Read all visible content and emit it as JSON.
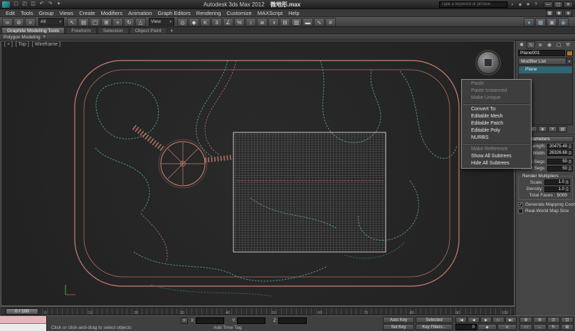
{
  "colors": {
    "road_accent": "#c97f70",
    "path_accent": "#57a093",
    "dark_path_accent": "#35704f",
    "selection_highlight": "#2e6672",
    "object_swatch": "#b4722c",
    "grid_line": "#c8c8c8",
    "red_dash": "#b34a42",
    "viewport_background": "#262626"
  },
  "title_bar": {
    "app_title": "Autodesk 3ds Max 2012",
    "document_name": "微地形.max",
    "search_placeholder": "Type a keyword or phrase",
    "quick_access": [
      {
        "name": "new-scene-icon",
        "glyph": "▢"
      },
      {
        "name": "open-file-icon",
        "glyph": "◰"
      },
      {
        "name": "save-file-icon",
        "glyph": "◫"
      },
      {
        "name": "undo-icon",
        "glyph": "↶"
      },
      {
        "name": "redo-icon",
        "glyph": "↷"
      },
      {
        "name": "project-folder-icon",
        "glyph": "▾"
      }
    ],
    "infocenter_icons": [
      {
        "name": "search-icon",
        "glyph": "⌕"
      },
      {
        "name": "communication-center-icon",
        "glyph": "◈"
      },
      {
        "name": "favorites-icon",
        "glyph": "★"
      },
      {
        "name": "help-icon",
        "glyph": "?"
      }
    ],
    "window_buttons": [
      {
        "name": "minimize-button",
        "glyph": "—"
      },
      {
        "name": "maximize-button",
        "glyph": "▢"
      },
      {
        "name": "close-button",
        "glyph": "✕"
      }
    ]
  },
  "menu_bar": {
    "items": [
      "Edit",
      "Tools",
      "Group",
      "Views",
      "Create",
      "Modifiers",
      "Animation",
      "Graph Editors",
      "Rendering",
      "Customize",
      "MAXScript",
      "Help"
    ],
    "right_icons": [
      {
        "name": "workspace-icon",
        "glyph": "▦"
      },
      {
        "name": "scene-explorer-icon",
        "glyph": "◉"
      },
      {
        "name": "info-icon",
        "glyph": "◈"
      }
    ]
  },
  "main_toolbar": {
    "group1": [
      {
        "name": "select-and-link-icon",
        "glyph": "∞"
      },
      {
        "name": "unlink-selection-icon",
        "glyph": "⊘"
      },
      {
        "name": "bind-to-space-warp-icon",
        "glyph": "≈"
      }
    ],
    "selection_filter_value": "All",
    "group2": [
      {
        "name": "select-object-icon",
        "glyph": "↖"
      },
      {
        "name": "select-by-name-icon",
        "glyph": "▤"
      },
      {
        "name": "selection-region-icon",
        "glyph": "▢"
      },
      {
        "name": "window-crossing-icon",
        "glyph": "⊞"
      },
      {
        "name": "select-and-move-icon",
        "glyph": "+"
      },
      {
        "name": "select-and-rotate-icon",
        "glyph": "↻"
      },
      {
        "name": "select-and-scale-icon",
        "glyph": "△"
      }
    ],
    "coord_system_value": "View",
    "group3": [
      {
        "name": "use-pivot-point-icon",
        "glyph": "◎"
      },
      {
        "name": "select-and-manipulate-icon",
        "glyph": "◆"
      },
      {
        "name": "keyboard-override-icon",
        "glyph": "K"
      },
      {
        "name": "snaps-toggle-icon",
        "glyph": "3"
      },
      {
        "name": "angle-snap-icon",
        "glyph": "∠"
      },
      {
        "name": "percent-snap-icon",
        "glyph": "%"
      },
      {
        "name": "spinner-snap-icon",
        "glyph": "↕"
      },
      {
        "name": "named-selection-sets-icon",
        "glyph": "≣"
      },
      {
        "name": "mirror-icon",
        "glyph": "◑"
      },
      {
        "name": "align-icon",
        "glyph": "⊟"
      },
      {
        "name": "layer-manager-icon",
        "glyph": "▥"
      },
      {
        "name": "graphite-ribbon-icon",
        "glyph": "▬"
      },
      {
        "name": "curve-editor-icon",
        "glyph": "∿"
      },
      {
        "name": "schematic-view-icon",
        "glyph": "#"
      }
    ],
    "group4": [
      {
        "name": "material-editor-icon",
        "glyph": "●",
        "color": "#49b8a8"
      },
      {
        "name": "render-setup-icon",
        "glyph": "▦",
        "color": "#9fb8d8"
      },
      {
        "name": "rendered-frame-icon",
        "glyph": "▣",
        "color": "#9fb8d8"
      },
      {
        "name": "render-production-icon",
        "glyph": "◉",
        "color": "#6aa4d8"
      }
    ]
  },
  "ribbon": {
    "tabs": [
      {
        "label": "Graphite Modeling Tools",
        "active": true
      },
      {
        "label": "Freeform"
      },
      {
        "label": "Selection"
      },
      {
        "label": "Object Paint"
      }
    ],
    "minimize_glyph": "▴",
    "collapsed_panel_label": "Polygon Modeling",
    "panel_arrow_glyph": "▼"
  },
  "viewport": {
    "overlay_labels": {
      "general": "[ + ]",
      "pov": "[ Top ]",
      "shading": "[ Wireframe ]"
    }
  },
  "context_menu": {
    "items": [
      {
        "label": "Paste",
        "disabled": true
      },
      {
        "label": "Paste Instanced",
        "disabled": true
      },
      {
        "label": "Make Unique",
        "disabled": true
      },
      {
        "type": "separator"
      },
      {
        "label": "Convert To:"
      },
      {
        "label": "Editable Mesh"
      },
      {
        "label": "Editable Patch"
      },
      {
        "label": "Editable Poly"
      },
      {
        "label": "NURBS"
      },
      {
        "type": "separator"
      },
      {
        "label": "Make Reference",
        "disabled": true
      },
      {
        "label": "Show All Subtrees"
      },
      {
        "label": "Hide All Subtrees"
      }
    ]
  },
  "command_panel": {
    "tabs": [
      {
        "name": "create-tab-icon",
        "glyph": "✱"
      },
      {
        "name": "modify-tab-icon",
        "glyph": "∿",
        "active": true
      },
      {
        "name": "hierarchy-tab-icon",
        "glyph": "≣"
      },
      {
        "name": "motion-tab-icon",
        "glyph": "◉"
      },
      {
        "name": "display-tab-icon",
        "glyph": "▢"
      },
      {
        "name": "utilities-tab-icon",
        "glyph": "⚒"
      }
    ],
    "object_name": "Plane001",
    "modifier_list_label": "Modifier List",
    "stack": [
      {
        "label": "Plane",
        "selected": true
      }
    ],
    "stack_tools": [
      {
        "name": "pin-stack-icon",
        "glyph": "⌖"
      },
      {
        "name": "show-end-result-icon",
        "glyph": "≡"
      },
      {
        "name": "make-unique-icon",
        "glyph": "◈"
      },
      {
        "name": "remove-modifier-icon",
        "glyph": "✕"
      },
      {
        "name": "configure-modifier-sets-icon",
        "glyph": "▤"
      }
    ],
    "parameters": {
      "title": "Parameters",
      "length_label": "Length:",
      "length_value": "20475.49",
      "width_label": "Width:",
      "width_value": "26326.68",
      "length_segs_label": "Length Segs:",
      "length_segs_value": "50",
      "width_segs_label": "Width Segs:",
      "width_segs_value": "50",
      "render_multipliers_title": "Render Multipliers",
      "scale_label": "Scale:",
      "scale_value": "1.0",
      "density_label": "Density:",
      "density_value": "1.0",
      "total_faces_label": "Total Faces :",
      "total_faces_value": "5000",
      "generate_mapping_label": "Generate Mapping Coords.",
      "generate_mapping_checked": true,
      "real_world_label": "Real-World Map Size",
      "real_world_checked": false
    }
  },
  "timeline": {
    "slider_label": "0 / 100",
    "ticks": [
      "0",
      "10",
      "20",
      "30",
      "40",
      "50",
      "60",
      "70",
      "80",
      "90",
      "100"
    ]
  },
  "status_bar": {
    "prompt_text": "Click or click-and-drag to select objects",
    "add_time_tag": "Add Time Tag",
    "coord_x_label": "X:",
    "coord_y_label": "Y:",
    "coord_z_label": "Z:",
    "coord_x_value": "",
    "coord_y_value": "",
    "coord_z_value": "",
    "auto_key_label": "Auto Key",
    "set_key_label": "Set Key",
    "selected_label": "Selected",
    "key_filters_label": "Key Filters...",
    "frame_value": "0",
    "playback": [
      {
        "name": "go-to-start-button",
        "glyph": "|◀"
      },
      {
        "name": "previous-frame-button",
        "glyph": "◀"
      },
      {
        "name": "play-button",
        "glyph": "▶"
      },
      {
        "name": "next-frame-button",
        "glyph": "▷"
      },
      {
        "name": "go-to-end-button",
        "glyph": "▶|"
      }
    ],
    "key_mode_icons": [
      {
        "name": "key-mode-toggle-icon",
        "glyph": "◆"
      },
      {
        "name": "time-configuration-icon",
        "glyph": "⊙"
      }
    ],
    "nav_icons": [
      {
        "name": "zoom-icon",
        "glyph": "⊕"
      },
      {
        "name": "zoom-all-icon",
        "glyph": "⊛"
      },
      {
        "name": "zoom-extents-icon",
        "glyph": "⊙"
      },
      {
        "name": "zoom-extents-all-icon",
        "glyph": "⊡"
      },
      {
        "name": "zoom-region-icon",
        "glyph": "▭"
      },
      {
        "name": "pan-icon",
        "glyph": "↔"
      },
      {
        "name": "orbit-icon",
        "glyph": "↻"
      },
      {
        "name": "maximize-viewport-icon",
        "glyph": "⊞"
      }
    ]
  }
}
